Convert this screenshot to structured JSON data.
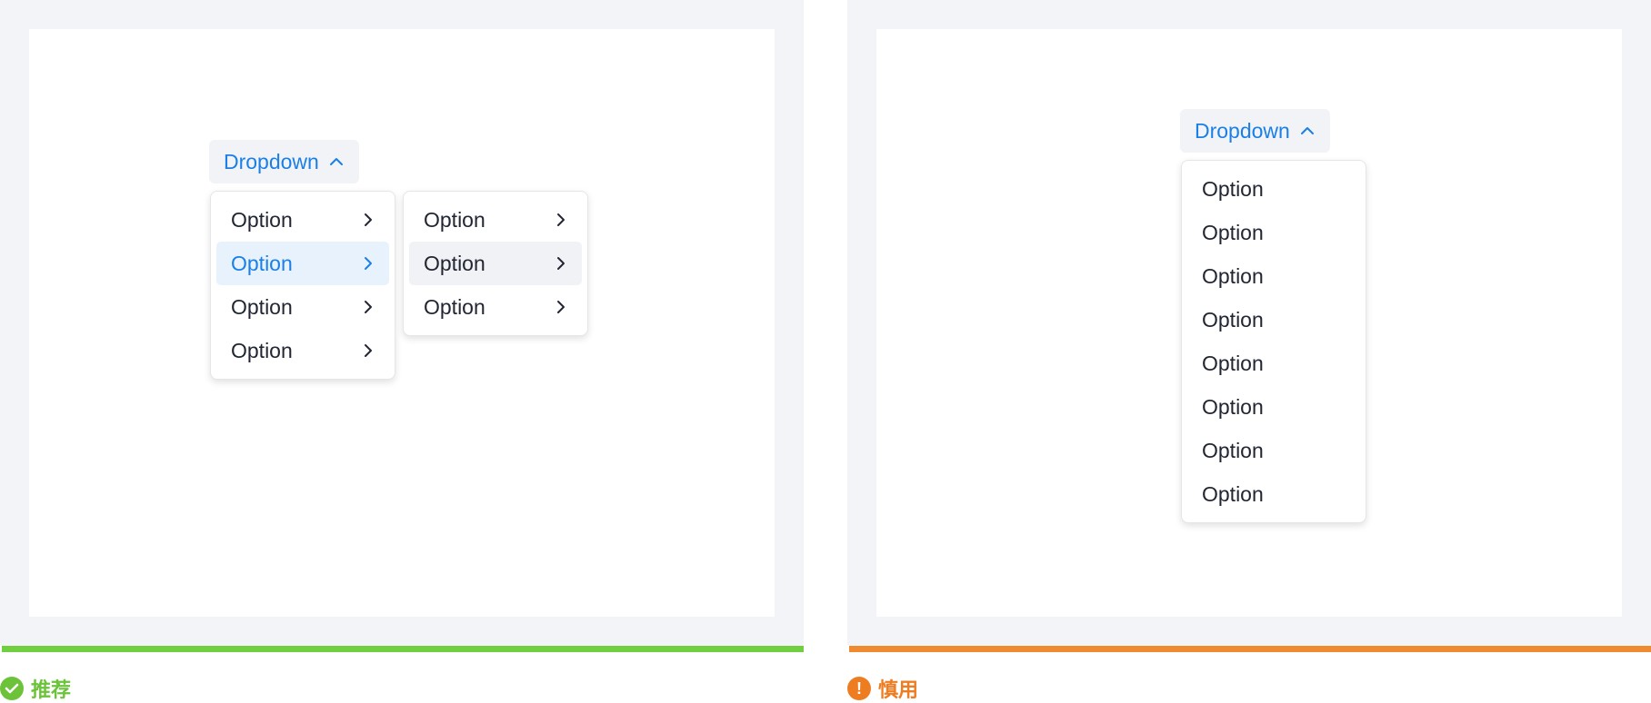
{
  "recommended": {
    "button_label": "Dropdown",
    "menu_items": [
      {
        "label": "Option",
        "state": "default"
      },
      {
        "label": "Option",
        "state": "active"
      },
      {
        "label": "Option",
        "state": "default"
      },
      {
        "label": "Option",
        "state": "default"
      }
    ],
    "submenu_items": [
      {
        "label": "Option",
        "state": "default"
      },
      {
        "label": "Option",
        "state": "hover"
      },
      {
        "label": "Option",
        "state": "default"
      }
    ],
    "verdict_label": "推荐",
    "verdict_icon": "check-circle-icon",
    "accent_color": "#6cc33a"
  },
  "caution": {
    "button_label": "Dropdown",
    "menu_items": [
      {
        "label": "Option"
      },
      {
        "label": "Option"
      },
      {
        "label": "Option"
      },
      {
        "label": "Option"
      },
      {
        "label": "Option"
      },
      {
        "label": "Option"
      },
      {
        "label": "Option"
      },
      {
        "label": "Option"
      }
    ],
    "verdict_label": "慎用",
    "verdict_icon": "exclamation-circle-icon",
    "accent_color": "#ee7d22"
  },
  "colors": {
    "primary": "#1a7fe6",
    "text": "#222633",
    "active_bg": "#e7f2fd",
    "hover_bg": "#f1f2f5"
  }
}
